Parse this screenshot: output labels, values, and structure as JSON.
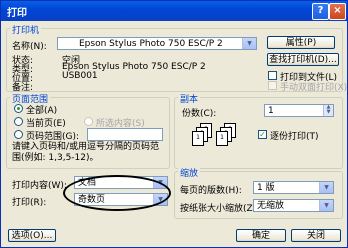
{
  "window": {
    "title": "打印",
    "help": "?",
    "close": "×"
  },
  "printer": {
    "legend": "打印机",
    "name_label": "名称(N):",
    "name_value": "Epson Stylus Photo 750 ESC/P 2",
    "properties_button": "属性(P)",
    "status_label": "状态:",
    "status_value": "空闲",
    "type_label": "类型:",
    "type_value": "Epson Stylus Photo 750 ESC/P 2",
    "location_label": "位置:",
    "location_value": "USB001",
    "remarks_label": "备注:",
    "find_button": "查找打印机(D)...",
    "print_to_file": "打印到文件(L)",
    "manual_duplex": "手动双面打印(X)"
  },
  "page_range": {
    "legend": "页面范围",
    "all": "全部(A)",
    "current": "当前页(E)",
    "selection": "所选内容(S)",
    "pages": "页码范围(G):",
    "pages_value": "",
    "hint": "请键入页码和/或用逗号分隔的页码范围(例如: 1,3,5-12)。"
  },
  "copies": {
    "legend": "副本",
    "count_label": "份数(C):",
    "count_value": "1",
    "collate": "逐份打印(T)",
    "page_labels": [
      "1",
      "2",
      "3",
      "1",
      "2",
      "3"
    ]
  },
  "print_what": {
    "label": "打印内容(W):",
    "value": "文档"
  },
  "print_mode": {
    "label": "打印(R):",
    "value": "奇数页"
  },
  "zoom": {
    "legend": "缩放",
    "pages_per_sheet_label": "每页的版数(H):",
    "pages_per_sheet_value": "1 版",
    "scale_label": "按纸张大小缩放(Z):",
    "scale_value": "无缩放"
  },
  "footer": {
    "options": "选项(O)...",
    "ok": "确定",
    "close": "关闭"
  }
}
